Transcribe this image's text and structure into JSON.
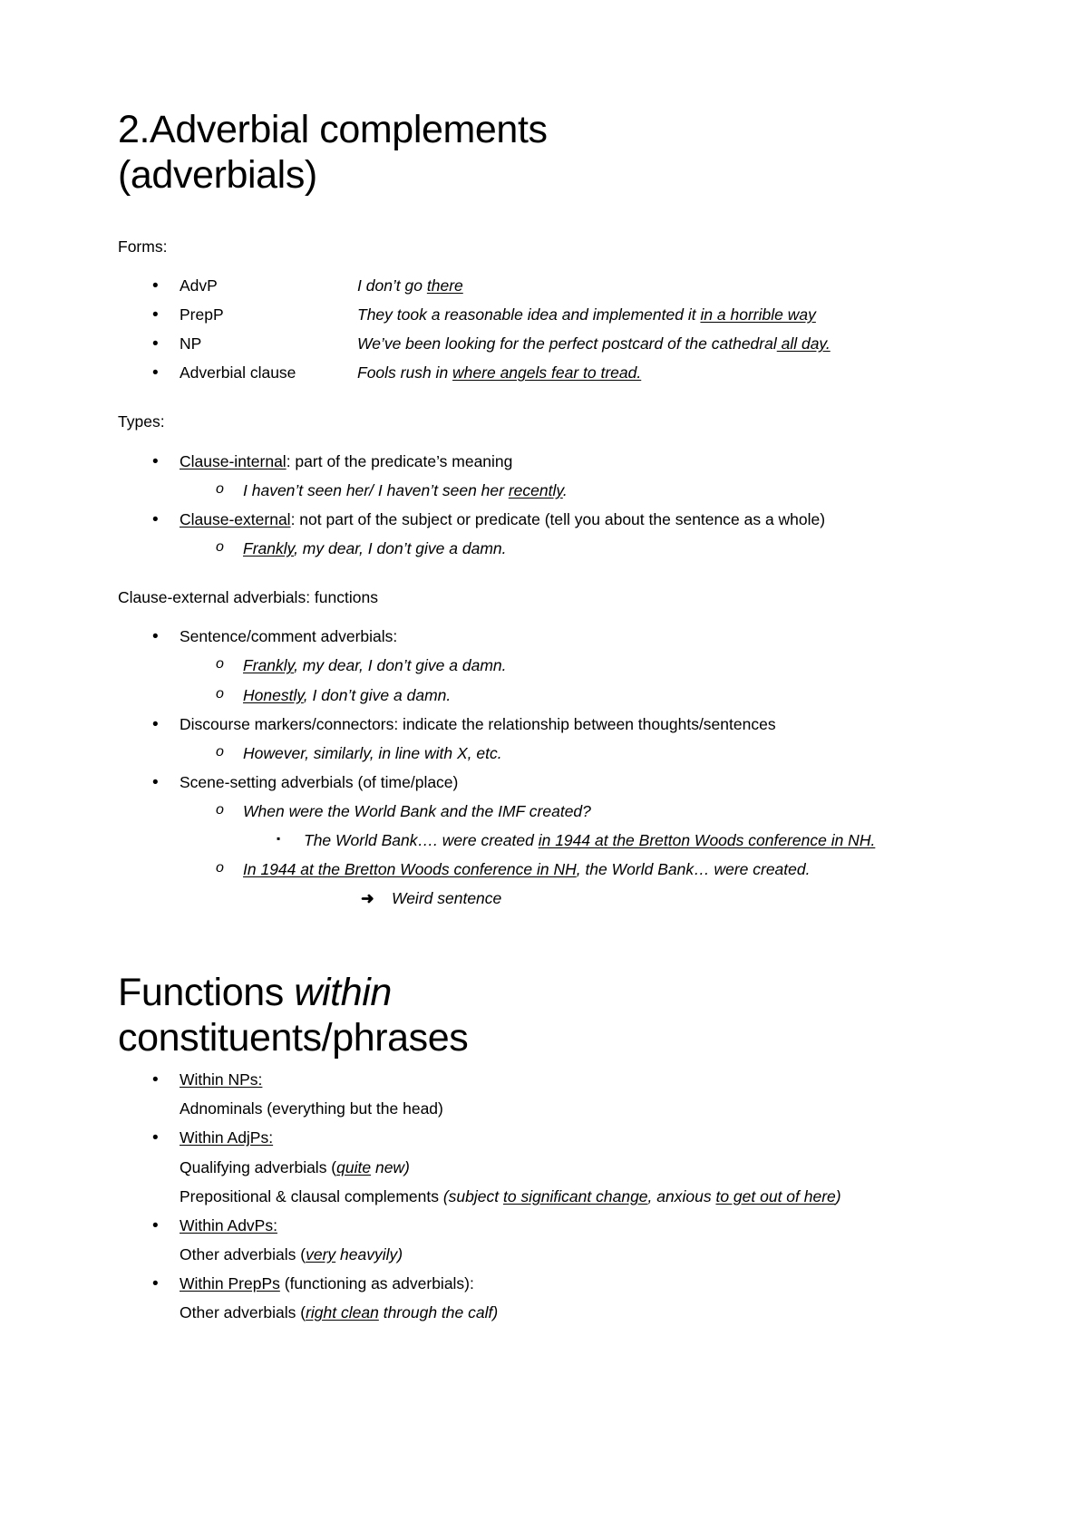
{
  "document": {
    "title_line1": "2.Adverbial complements",
    "title_line2": "(adverbials)",
    "forms_heading": "Forms:",
    "types_heading": "Types:",
    "functions_heading": "Clause-external adverbials: functions",
    "second_title_part1": "Functions ",
    "second_title_italic": "within",
    "second_title_line2": "constituents/phrases"
  },
  "forms": {
    "items": [
      {
        "label": "AdvP",
        "example_pre": "I don’t go ",
        "example_underline": "there",
        "example_post": ""
      },
      {
        "label": "PrepP",
        "example_pre": "They took a reasonable idea and implemented it ",
        "example_underline": "in a horrible way",
        "example_post": ""
      },
      {
        "label": "NP",
        "example_pre": "We’ve been looking for the perfect postcard of the cathedral",
        "example_underline": " all day.",
        "example_post": ""
      },
      {
        "label": "Adverbial clause",
        "example_pre": "Fools rush in ",
        "example_underline": "where angels fear to tread.",
        "example_post": ""
      }
    ]
  },
  "types": {
    "items": [
      {
        "term": "Clause-internal",
        "rest": ": part of the predicate’s meaning",
        "sub_pre": "I haven’t seen her/ I haven’t seen her ",
        "sub_underline": "recently",
        "sub_post": "."
      },
      {
        "term": "Clause-external",
        "rest": ": not part of the subject or predicate (tell you about the sentence as a whole)",
        "sub_pre": "",
        "sub_underline": "Frankly",
        "sub_post": ", my dear, I don’t give a damn."
      }
    ]
  },
  "functions": {
    "groups": [
      {
        "heading": "Sentence/comment adverbials:",
        "subs": [
          {
            "pre": "",
            "underline": "Frankly",
            "post": ", my dear, I don’t give a damn."
          },
          {
            "pre": "",
            "underline": "Honestly",
            "post": ", I don’t give a damn."
          }
        ],
        "third": []
      },
      {
        "heading": "Discourse markers/connectors: indicate the relationship between thoughts/sentences",
        "subs": [
          {
            "pre": "However, similarly, in line with X, etc.",
            "underline": "",
            "post": ""
          }
        ],
        "third": []
      },
      {
        "heading": "Scene-setting adverbials (of time/place)",
        "subs": [
          {
            "pre": "When were the World Bank and the IMF created?",
            "underline": "",
            "post": ""
          }
        ],
        "third": [
          {
            "pre": "The World Bank…. were created ",
            "underline": "in 1944 at the Bretton Woods conference in NH.",
            "post": ""
          }
        ]
      }
    ],
    "final_sub": {
      "underline": "In 1944 at the Bretton Woods conference in NH",
      "post": ", the World Bank… were created."
    },
    "arrow": {
      "glyph": "➜",
      "label": "Weird sentence"
    }
  },
  "within": {
    "items": [
      {
        "head": "Within NPs: ",
        "lines": [
          {
            "pre": "Adnominals (everything but the head)",
            "underline": "",
            "mid": "",
            "post": ""
          }
        ]
      },
      {
        "head": "Within AdjPs:",
        "lines": [
          {
            "pre": "Qualifying adverbials (",
            "underline": "quite",
            "mid": " new)",
            "post": ""
          },
          {
            "pre": "Prepositional & clausal complements ",
            "italic_open": "(subject ",
            "underline": "to significant change",
            "mid": ", anxious ",
            "underline2": "to get out of here",
            "post": ")"
          }
        ]
      },
      {
        "head": "Within AdvPs:",
        "lines": [
          {
            "pre": "Other adverbials (",
            "underline": "very",
            "mid": " heavyily)",
            "post": ""
          }
        ]
      },
      {
        "head": "Within PrepPs",
        "head_post": " (functioning as adverbials):",
        "lines": [
          {
            "pre": "Other adverbials (",
            "underline": "right clean",
            "mid": " through the calf)",
            "post": ""
          }
        ]
      }
    ]
  },
  "icons": {
    "bullet_disc": "•",
    "bullet_circle": "o",
    "bullet_square": "▪",
    "arrow_right": "➜"
  }
}
